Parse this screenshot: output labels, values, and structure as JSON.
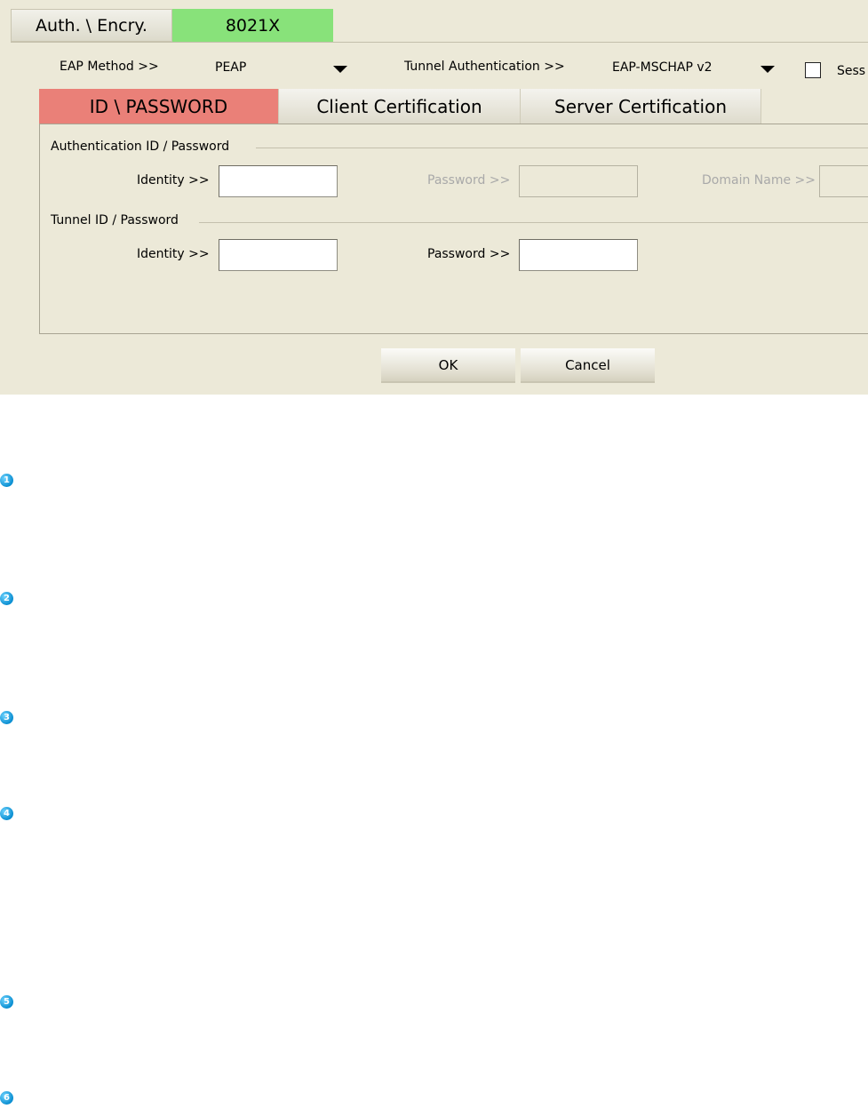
{
  "tabs": {
    "auth_encry": "Auth. \\ Encry.",
    "x8021": "8021X"
  },
  "eap": {
    "method_label": "EAP Method >>",
    "method_value": "PEAP",
    "tunnel_label": "Tunnel Authentication >>",
    "tunnel_value": "EAP-MSCHAP v2",
    "session_label": "Sess"
  },
  "subtabs": {
    "id_password": "ID \\ PASSWORD",
    "client_cert": "Client Certification",
    "server_cert": "Server Certification"
  },
  "auth_group": {
    "legend": "Authentication ID / Password",
    "identity_label": "Identity >>",
    "identity_value": "",
    "password_label": "Password >>",
    "domain_label": "Domain Name >>"
  },
  "tunnel_group": {
    "legend": "Tunnel ID / Password",
    "identity_label": "Identity >>",
    "identity_value": "",
    "password_label": "Password >>",
    "password_value": ""
  },
  "buttons": {
    "ok": "OK",
    "cancel": "Cancel"
  },
  "markers": [
    "1",
    "2",
    "3",
    "4",
    "5",
    "6"
  ],
  "colors": {
    "active_tab": "#88e27a",
    "active_subtab": "#ea8078",
    "dialog_bg": "#ece9d8",
    "marker": "#0a8ed1"
  }
}
